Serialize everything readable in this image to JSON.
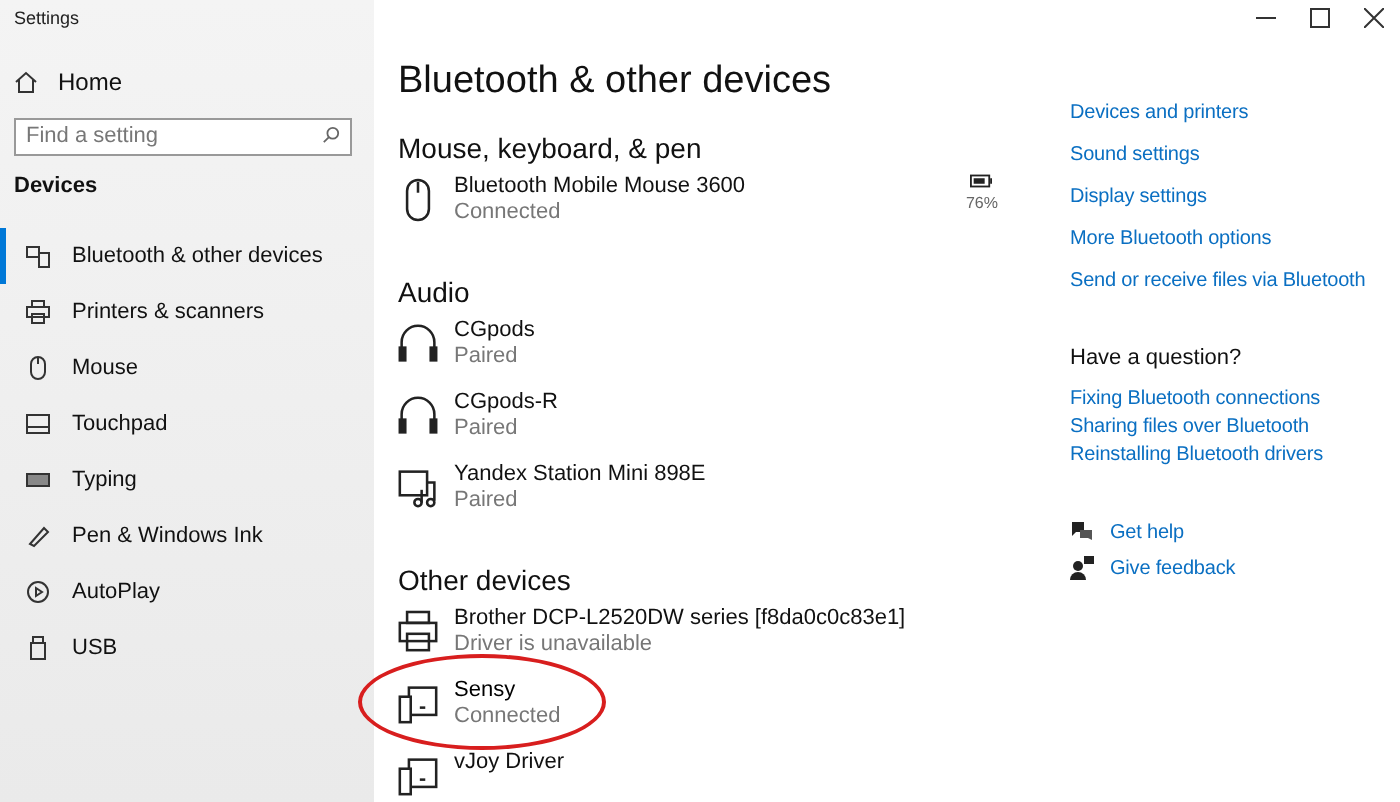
{
  "window": {
    "title": "Settings"
  },
  "sidebar": {
    "home": "Home",
    "search": {
      "placeholder": "Find a setting"
    },
    "heading": "Devices",
    "items": [
      {
        "label": "Bluetooth & other devices",
        "kind": "bluetooth",
        "selected": true
      },
      {
        "label": "Printers & scanners",
        "kind": "printer",
        "selected": false
      },
      {
        "label": "Mouse",
        "kind": "mouse",
        "selected": false
      },
      {
        "label": "Touchpad",
        "kind": "touchpad",
        "selected": false
      },
      {
        "label": "Typing",
        "kind": "keyboard",
        "selected": false
      },
      {
        "label": "Pen & Windows Ink",
        "kind": "pen",
        "selected": false
      },
      {
        "label": "AutoPlay",
        "kind": "autoplay",
        "selected": false
      },
      {
        "label": "USB",
        "kind": "usb",
        "selected": false
      }
    ]
  },
  "main": {
    "title": "Bluetooth & other devices",
    "sections": [
      {
        "heading": "Mouse, keyboard, & pen",
        "devices": [
          {
            "name": "Bluetooth Mobile Mouse 3600",
            "status": "Connected",
            "kind": "mouse",
            "battery": "76%",
            "highlighted": false
          }
        ]
      },
      {
        "heading": "Audio",
        "devices": [
          {
            "name": "CGpods",
            "status": "Paired",
            "kind": "headphones",
            "highlighted": false
          },
          {
            "name": "CGpods-R",
            "status": "Paired",
            "kind": "headphones",
            "highlighted": false
          },
          {
            "name": "Yandex Station Mini 898E",
            "status": "Paired",
            "kind": "speaker",
            "highlighted": false
          }
        ]
      },
      {
        "heading": "Other devices",
        "devices": [
          {
            "name": "Brother DCP-L2520DW series [f8da0c0c83e1]",
            "status": "Driver is unavailable",
            "kind": "printer",
            "highlighted": false
          },
          {
            "name": "Sensy",
            "status": "Connected",
            "kind": "device",
            "highlighted": true
          },
          {
            "name": "vJoy Driver",
            "kind": "device",
            "highlighted": false
          }
        ]
      }
    ]
  },
  "related": {
    "links": [
      "Devices and printers",
      "Sound settings",
      "Display settings",
      "More Bluetooth options",
      "Send or receive files via Bluetooth"
    ],
    "question": "Have a question?",
    "help_links": [
      "Fixing Bluetooth connections",
      "Sharing files over Bluetooth",
      "Reinstalling Bluetooth drivers"
    ],
    "support": [
      {
        "label": "Get help",
        "kind": "help"
      },
      {
        "label": "Give feedback",
        "kind": "feedback"
      }
    ]
  }
}
